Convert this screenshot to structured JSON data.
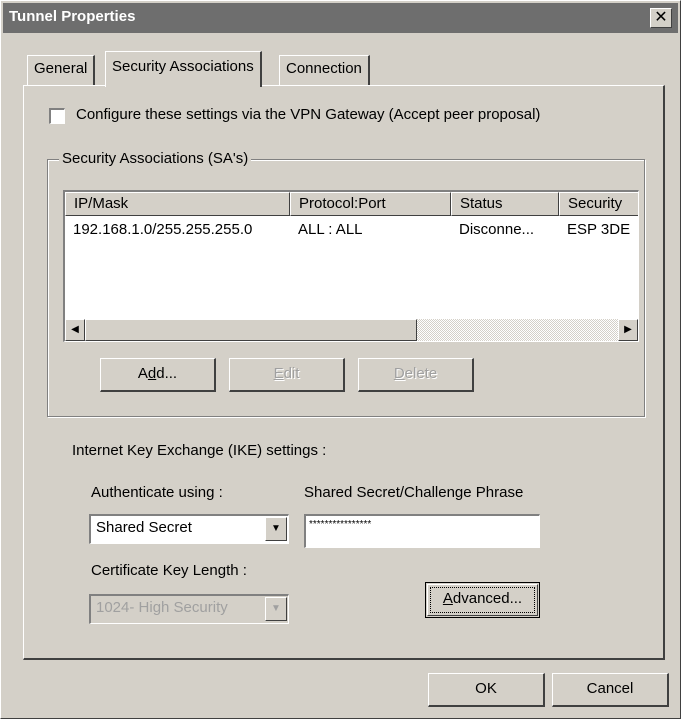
{
  "window": {
    "title": "Tunnel Properties",
    "close_glyph": "✕"
  },
  "tabs": [
    {
      "label": "General",
      "active": false
    },
    {
      "label": "Security Associations",
      "active": true
    },
    {
      "label": "Connection",
      "active": false
    }
  ],
  "configure_checkbox": {
    "label": "Configure these settings via the VPN Gateway  (Accept peer proposal)",
    "checked": false
  },
  "sa_group": {
    "label": "Security Associations (SA's)",
    "columns": [
      "IP/Mask",
      "Protocol:Port",
      "Status",
      "Security"
    ],
    "rows": [
      [
        "192.168.1.0/255.255.255.0",
        "ALL : ALL",
        "Disconne...",
        "ESP 3DE"
      ]
    ],
    "buttons": {
      "add_pre": "A",
      "add_mn": "d",
      "add_post": "d...",
      "edit_pre": "",
      "edit_mn": "E",
      "edit_post": "dit",
      "delete_pre": "",
      "delete_mn": "D",
      "delete_post": "elete"
    }
  },
  "ike": {
    "label": "Internet Key Exchange (IKE) settings :",
    "auth_label": "Authenticate using :",
    "auth_value": "Shared Secret",
    "secret_label": "Shared Secret/Challenge Phrase",
    "secret_value": "****************",
    "cert_label": "Certificate Key Length :",
    "cert_value": "1024- High Security",
    "advanced_pre": "",
    "advanced_mn": "A",
    "advanced_post": "dvanced..."
  },
  "footer": {
    "ok_label": "OK",
    "cancel_label": "Cancel"
  },
  "icons": {
    "close": "close-icon",
    "dropdown": "chevron-down-icon",
    "scroll_left": "triangle-left-icon",
    "scroll_right": "triangle-right-icon"
  }
}
